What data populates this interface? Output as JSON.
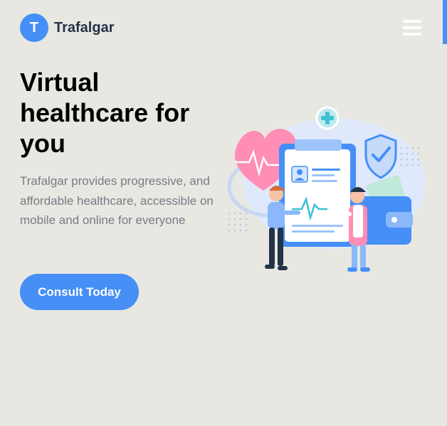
{
  "header": {
    "logo_letter": "T",
    "brand": "Trafalgar",
    "menu_icon": "hamburger-menu-icon"
  },
  "hero": {
    "headline": "Virtual healthcare for you",
    "description": "Trafalgar provides progressive, and affordable healthcare, accessible on mobile and online for everyone",
    "cta_label": "Consult Today",
    "illustration": "healthcare-illustration"
  },
  "colors": {
    "primary": "#458ff6",
    "background": "#e8e7e1",
    "heading": "#000000",
    "body_text": "#7d7987",
    "brand_text": "#233348"
  }
}
